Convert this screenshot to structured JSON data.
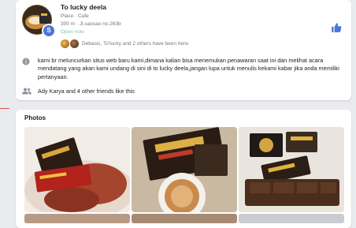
{
  "place": {
    "name": "To lucky deela",
    "category": "Place · Cafe",
    "address": "300 m · Jl.saosao no.263b",
    "hours": "Open now",
    "visitors_text": "Debasic, To'lucky and 2 others have been here.",
    "badge_letter": "S"
  },
  "about": {
    "text": "kami br meluncurkan situs web baru kami,dimana kalian bisa menemukan penawaran saat ini dan melihat acara mendatang yang akan kami undang di sini di to lucky deela,jangan lupa untuk menulis kekami kabar jika anda memiliki pertanyaan."
  },
  "friends": {
    "text": "Ady Karya and 4 other friends like this"
  },
  "photos": {
    "title": "Photos"
  },
  "icons": {
    "info": "info-icon",
    "friends": "friends-icon",
    "like": "thumbs-up-icon"
  },
  "colors": {
    "brand": "#4a76d8",
    "open": "#8cc5a0",
    "background": "#e9ebee"
  }
}
